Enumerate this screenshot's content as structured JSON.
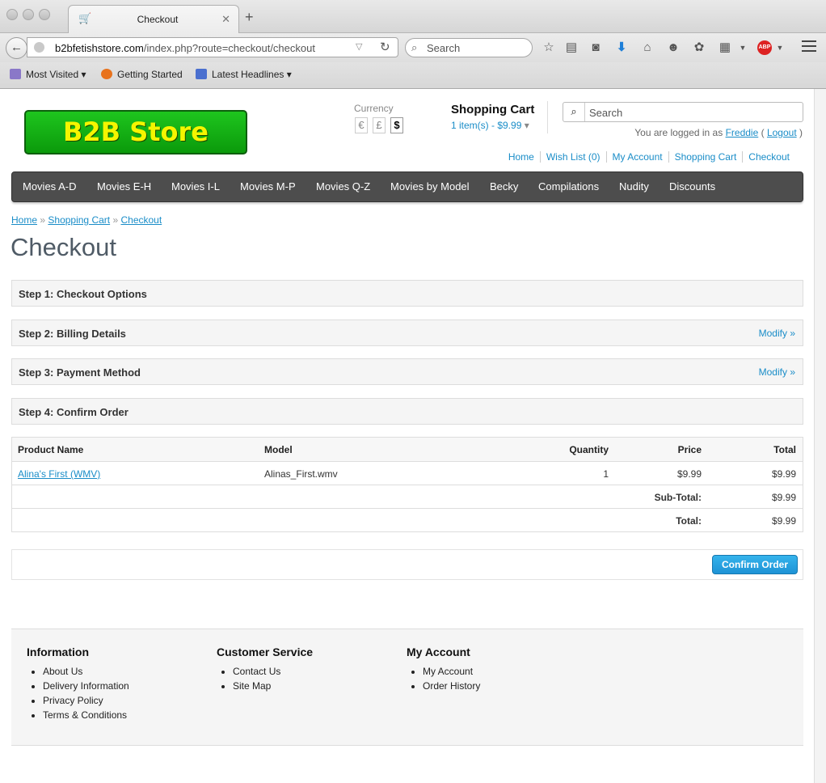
{
  "browser": {
    "tab_title": "Checkout",
    "new_tab": "+",
    "url_host": "b2bfetishstore.com",
    "url_path": "/index.php?route=checkout/checkout",
    "search_placeholder": "Search",
    "bookmarks": [
      "Most Visited",
      "Getting Started",
      "Latest Headlines"
    ],
    "abp_label": "ABP"
  },
  "header": {
    "logo_text": "B2B Store",
    "currency_label": "Currency",
    "currencies": [
      "€",
      "£",
      "$"
    ],
    "cart_title": "Shopping Cart",
    "cart_info": "1 item(s) - $9.99",
    "search_placeholder": "Search",
    "logged_prefix": "You are logged in as",
    "user": "Freddie",
    "logout": "Logout",
    "paren_open": "(",
    "paren_close": ")",
    "top_links": [
      "Home",
      "Wish List (0)",
      "My Account",
      "Shopping Cart",
      "Checkout"
    ]
  },
  "nav": [
    "Movies A-D",
    "Movies E-H",
    "Movies I-L",
    "Movies M-P",
    "Movies Q-Z",
    "Movies by Model",
    "Becky",
    "Compilations",
    "Nudity",
    "Discounts"
  ],
  "breadcrumb": [
    "Home",
    "Shopping Cart",
    "Checkout"
  ],
  "breadcrumb_sep": "»",
  "page_title": "Checkout",
  "steps": [
    {
      "title": "Step 1: Checkout Options",
      "modify": ""
    },
    {
      "title": "Step 2: Billing Details",
      "modify": "Modify »"
    },
    {
      "title": "Step 3: Payment Method",
      "modify": "Modify »"
    },
    {
      "title": "Step 4: Confirm Order",
      "modify": ""
    }
  ],
  "order": {
    "headers": {
      "name": "Product Name",
      "model": "Model",
      "qty": "Quantity",
      "price": "Price",
      "total": "Total"
    },
    "item": {
      "name": "Alina's First (WMV)",
      "model": "Alinas_First.wmv",
      "qty": "1",
      "price": "$9.99",
      "total": "$9.99"
    },
    "subtotal_label": "Sub-Total:",
    "subtotal": "$9.99",
    "total_label": "Total:",
    "total": "$9.99"
  },
  "confirm_button": "Confirm Order",
  "footer": {
    "information": {
      "title": "Information",
      "items": [
        "About Us",
        "Delivery Information",
        "Privacy Policy",
        "Terms & Conditions"
      ]
    },
    "customer_service": {
      "title": "Customer Service",
      "items": [
        "Contact Us",
        "Site Map"
      ]
    },
    "my_account": {
      "title": "My Account",
      "items": [
        "My Account",
        "Order History"
      ]
    }
  }
}
